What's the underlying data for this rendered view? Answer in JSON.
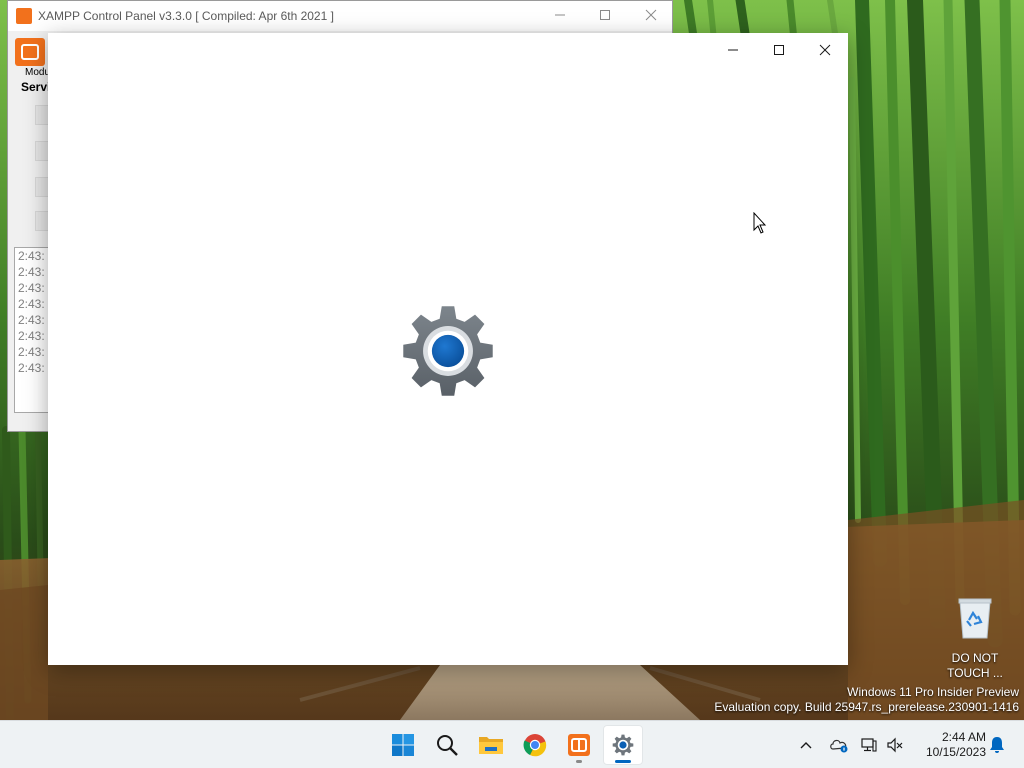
{
  "xampp": {
    "title": "XAMPP Control Panel v3.3.0   [ Compiled: Apr 6th 2021 ]",
    "modules_label": "Modu",
    "service_label": "Servi",
    "log_lines": [
      "2:43:",
      "2:43:",
      "2:43:",
      "2:43:",
      "2:43:",
      "2:43:",
      "2:43:",
      "2:43:"
    ],
    "icon": "xampp-logo-icon"
  },
  "settings_window": {
    "splash_icon": "settings-gear-icon",
    "controls": {
      "minimize": "minimize-icon",
      "maximize": "maximize-icon",
      "close": "close-icon"
    }
  },
  "desktop": {
    "recycle_bin_label_line1": "DO NOT",
    "recycle_bin_label_line2": "TOUCH ...",
    "watermark_line1": "Windows 11 Pro Insider Preview",
    "watermark_line2": "Evaluation copy. Build 25947.rs_prerelease.230901-1416"
  },
  "taskbar": {
    "apps": [
      "start-icon",
      "search-icon",
      "file-explorer-icon",
      "chrome-icon",
      "xampp-icon",
      "settings-icon"
    ],
    "clock_time": "2:44 AM",
    "clock_date": "10/15/2023"
  },
  "colors": {
    "accent": "#0067c0",
    "xampp_orange": "#f2711c",
    "gear_grey": "#6e757c",
    "gear_blue": "#0b5fb4"
  }
}
